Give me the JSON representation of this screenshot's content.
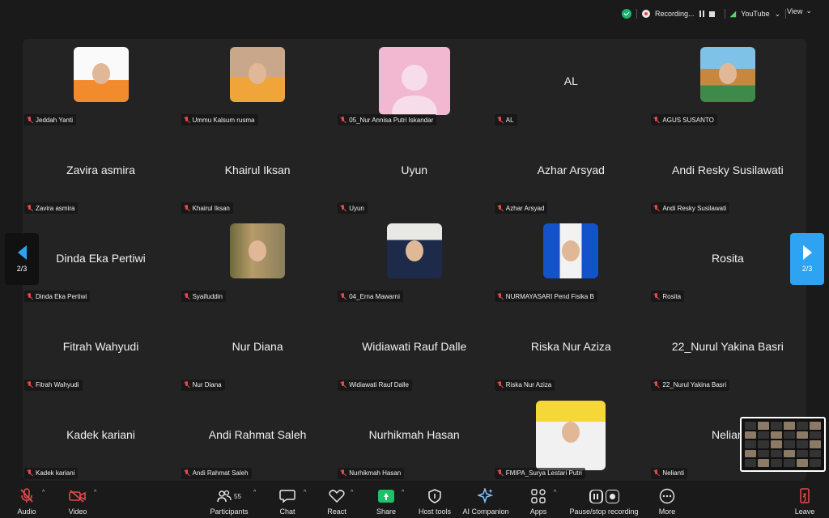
{
  "topbar": {
    "recording_label": "Recording...",
    "stream_label": "YouTube",
    "stream_caret": "⌄",
    "view_label": "View",
    "view_caret": "⌄"
  },
  "colors": {
    "accent": "#2ea3f2",
    "share_green": "#1fc06a",
    "muted_red": "#e24a4a",
    "secure_green": "#19b46b"
  },
  "gallery": {
    "participants": [
      {
        "display": "",
        "label": "Jeddah Yanti",
        "has_video": true,
        "photo": "girl-hijab-orange"
      },
      {
        "display": "",
        "label": "Ummu Kalsum rusma",
        "has_video": true,
        "photo": "girl-hijab-beige"
      },
      {
        "display": "",
        "label": "05_Nur Annisa Putri Iskandar",
        "has_video": true,
        "photo": "pink-avatar"
      },
      {
        "display": "AL",
        "label": "AL",
        "has_video": false
      },
      {
        "display": "",
        "label": "AGUS SUSANTO",
        "has_video": true,
        "photo": "landscape"
      },
      {
        "display": "Zavira asmira",
        "label": "Zavira asmira",
        "has_video": false
      },
      {
        "display": "Khairul Iksan",
        "label": "Khairul Iksan",
        "has_video": false
      },
      {
        "display": "Uyun",
        "label": "Uyun",
        "has_video": false
      },
      {
        "display": "Azhar Arsyad",
        "label": "Azhar Arsyad",
        "has_video": false
      },
      {
        "display": "Andi Resky Susilawati",
        "label": "Andi Resky Susilawati",
        "has_video": false
      },
      {
        "display": "Dinda Eka Pertiwi",
        "label": "Dinda Eka Pertiwi",
        "has_video": false
      },
      {
        "display": "",
        "label": "Syaifuddin",
        "has_video": true,
        "photo": "man-poster"
      },
      {
        "display": "",
        "label": "04_Erna Mawarni",
        "has_video": true,
        "photo": "girl-hijab-navy"
      },
      {
        "display": "",
        "label": "NURMAYASARI Pend Fisika B",
        "has_video": true,
        "photo": "girl-blue-bg"
      },
      {
        "display": "Rosita",
        "label": "Rosita",
        "has_video": false
      },
      {
        "display": "Fitrah Wahyudi",
        "label": "Fitrah Wahyudi",
        "has_video": false
      },
      {
        "display": "Nur Diana",
        "label": "Nur Diana",
        "has_video": false
      },
      {
        "display": "Widiawati Rauf Dalle",
        "label": "Widiawati Rauf Dalle",
        "has_video": false
      },
      {
        "display": "Riska Nur Aziza",
        "label": "Riska Nur Aziza",
        "has_video": false
      },
      {
        "display": "22_Nurul Yakina Basri",
        "label": "22_Nurul Yakina Basri",
        "has_video": false
      },
      {
        "display": "Kadek kariani",
        "label": "Kadek kariani",
        "has_video": false
      },
      {
        "display": "Andi Rahmat Saleh",
        "label": "Andi Rahmat Saleh",
        "has_video": false
      },
      {
        "display": "Nurhikmah Hasan",
        "label": "Nurhikmah Hasan",
        "has_video": false
      },
      {
        "display": "",
        "label": "FMIPA_Surya Lestari Putri",
        "has_video": true,
        "photo": "girl-white-hijab"
      },
      {
        "display": "Nelian",
        "label": "Nelianti",
        "has_video": false
      }
    ]
  },
  "pagination": {
    "left_label": "2/3",
    "right_label": "2/3"
  },
  "toolbar": {
    "audio": "Audio",
    "video": "Video",
    "participants": "Participants",
    "participants_count": "55",
    "chat": "Chat",
    "react": "React",
    "share": "Share",
    "host_tools": "Host tools",
    "ai_companion": "AI Companion",
    "apps": "Apps",
    "recording": "Pause/stop recording",
    "more": "More",
    "leave": "Leave",
    "caret": "^"
  }
}
